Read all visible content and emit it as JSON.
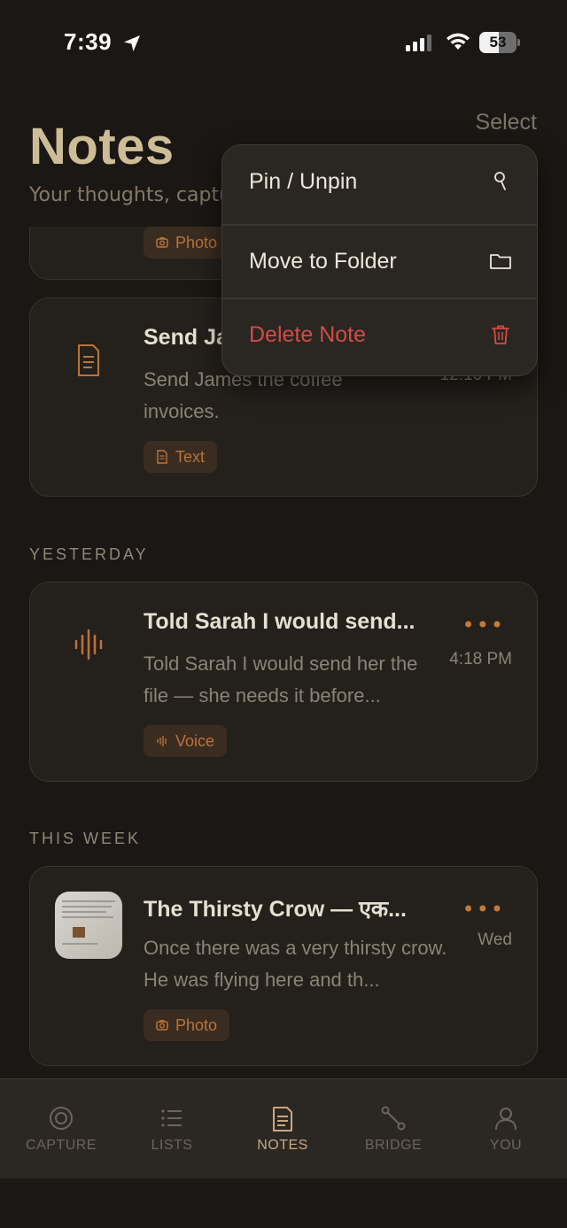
{
  "status": {
    "time": "7:39",
    "battery": "53",
    "battery_level": 0.53
  },
  "header": {
    "title": "Notes",
    "subtitle": "Your thoughts, captured",
    "select_label": "Select"
  },
  "notes": {
    "partial_card": {
      "tag": "Photo"
    },
    "coffee_card": {
      "title": "Send James the coffee invoices",
      "body": "Send James the coffee invoices.",
      "time": "12:10 PM",
      "tag": "Text"
    },
    "yesterday_label": "YESTERDAY",
    "sarah_card": {
      "title": "Told Sarah I would send...",
      "body": "Told Sarah I would send her the file — she needs it before...",
      "time": "4:18 PM",
      "tag": "Voice",
      "more": "•••"
    },
    "this_week_label": "THIS WEEK",
    "crow_card": {
      "title": "The Thirsty Crow — एक...",
      "body": "Once there was a very thirsty crow. He was flying here and th...",
      "time": "Wed",
      "tag": "Photo",
      "more": "•••"
    }
  },
  "context_menu": {
    "pin_label": "Pin / Unpin",
    "move_label": "Move to Folder",
    "delete_label": "Delete Note"
  },
  "tabs": [
    {
      "label": "CAPTURE",
      "icon": "capture-icon"
    },
    {
      "label": "LISTS",
      "icon": "list-icon"
    },
    {
      "label": "NOTES",
      "icon": "note-icon",
      "active": true
    },
    {
      "label": "BRIDGE",
      "icon": "bridge-icon"
    },
    {
      "label": "YOU",
      "icon": "person-icon"
    }
  ],
  "colors": {
    "background": "#1a1714",
    "accent": "#c27a3a",
    "title": "#cdbd97",
    "delete": "#d24c45"
  }
}
